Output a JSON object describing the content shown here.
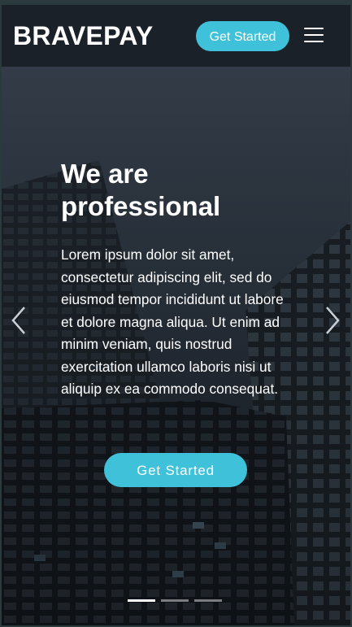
{
  "header": {
    "brand": "BRAVEPAY",
    "cta_label": "Get Started",
    "menu_icon": "hamburger-menu-icon"
  },
  "hero": {
    "title": "We are professional",
    "text": "Lorem ipsum dolor sit amet, consectetur adipiscing elit, sed do eiusmod tempor incididunt ut labore et dolore magna aliqua. Ut enim ad minim veniam, quis nostrud exercitation ullamco laboris nisi ut aliquip ex ea commodo consequat.",
    "cta_label": "Get Started",
    "prev_icon": "chevron-left-icon",
    "next_icon": "chevron-right-icon",
    "slides_count": 3,
    "active_slide": 1
  },
  "colors": {
    "accent": "#3fc1d9",
    "navbar_bg": "#1b2129",
    "text": "#ffffff"
  }
}
